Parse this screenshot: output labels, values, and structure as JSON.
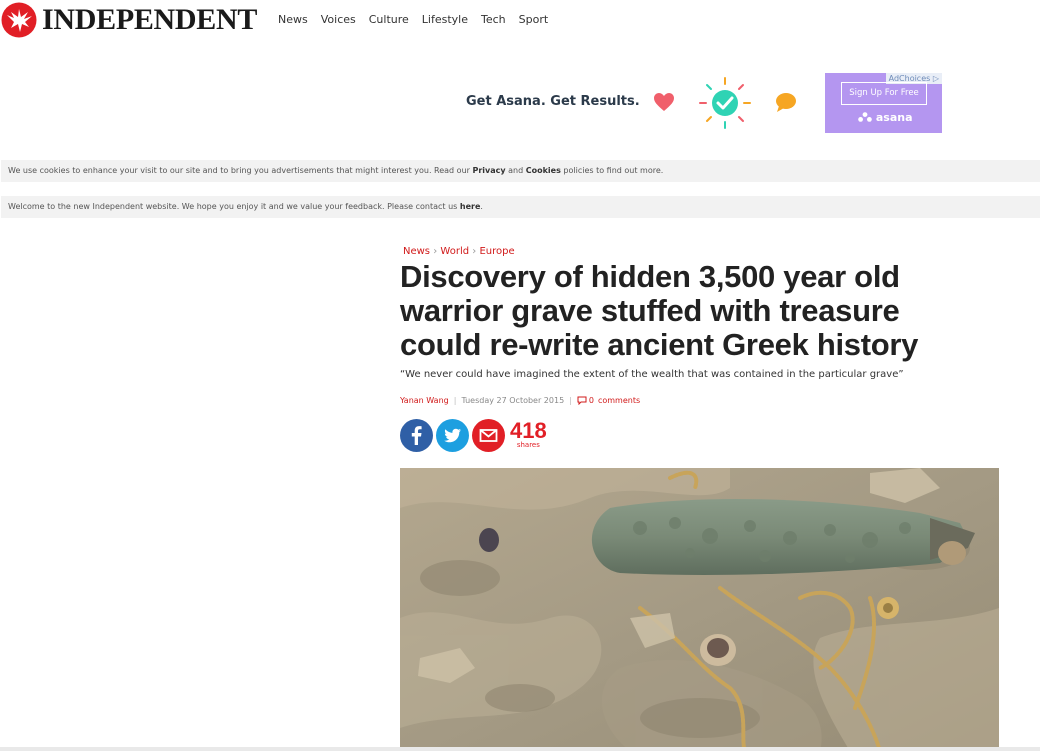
{
  "header": {
    "logo_text": "INDEPENDENT",
    "nav": [
      "News",
      "Voices",
      "Culture",
      "Lifestyle",
      "Tech",
      "Sport"
    ]
  },
  "ad": {
    "headline": "Get Asana. Get Results.",
    "choices_label": "AdChoices",
    "cta": "Sign Up For Free",
    "brand": "asana",
    "box_color": "#b496f0"
  },
  "banners": {
    "cookies": {
      "before": "We use cookies to enhance your visit to our site and to bring you advertisements that might interest you. Read our ",
      "link1": "Privacy",
      "mid": " and ",
      "link2": "Cookies",
      "after": " policies to find out more."
    },
    "welcome": {
      "before": "Welcome to the new Independent website. We hope you enjoy it and we value your feedback. Please contact us ",
      "link": "here",
      "after": "."
    }
  },
  "article": {
    "breadcrumb": [
      "News",
      "World",
      "Europe"
    ],
    "breadcrumb_sep": "›",
    "headline": "Discovery of hidden 3,500 year old warrior grave stuffed with treasure could re-write ancient Greek history",
    "standfirst": "“We never could have imagined the extent of the wealth that was contained in the particular grave”",
    "author": "Yanan Wang",
    "date": "Tuesday 27 October 2015",
    "comments_count": "0",
    "comments_label": "comments",
    "shares_count": "418",
    "shares_label": "shares"
  },
  "colors": {
    "accent_red": "#e11f26",
    "facebook": "#2f5fa6",
    "twitter": "#1d9fe0"
  }
}
